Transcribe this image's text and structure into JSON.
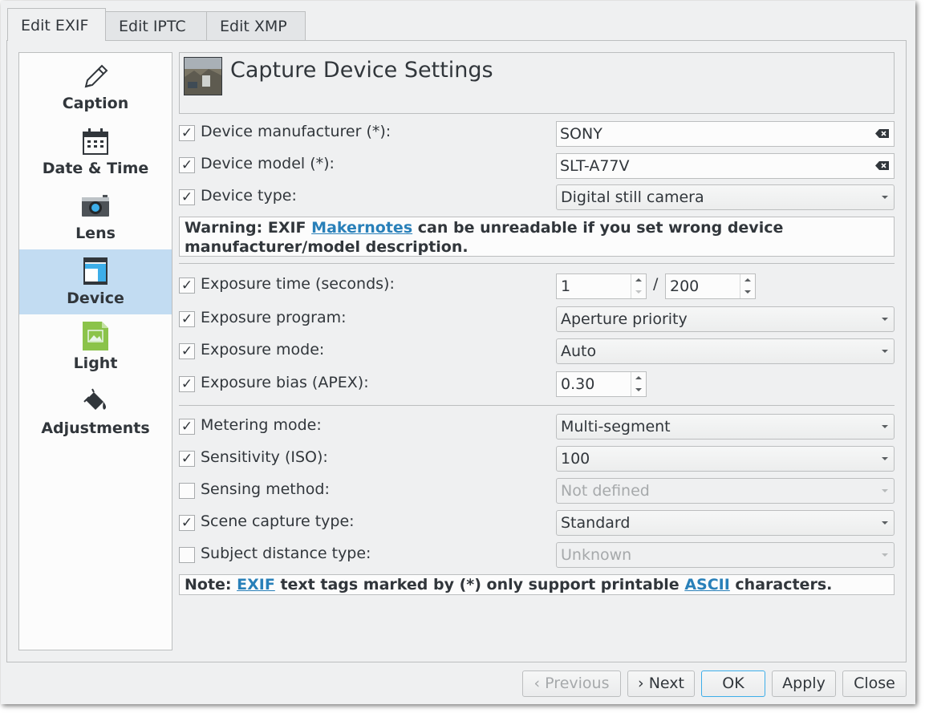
{
  "tabs": [
    {
      "label": "Edit EXIF"
    },
    {
      "label": "Edit IPTC"
    },
    {
      "label": "Edit XMP"
    }
  ],
  "sidebar": {
    "items": [
      {
        "label": "Caption",
        "icon": "pencil-icon"
      },
      {
        "label": "Date & Time",
        "icon": "calendar-icon"
      },
      {
        "label": "Lens",
        "icon": "camera-icon"
      },
      {
        "label": "Device",
        "icon": "device-icon",
        "selected": true
      },
      {
        "label": "Light",
        "icon": "image-icon"
      },
      {
        "label": "Adjustments",
        "icon": "paint-bucket-icon"
      }
    ]
  },
  "header": {
    "title": "Capture Device Settings"
  },
  "device": {
    "manufacturer": {
      "label": "Device manufacturer (*):",
      "checked": true,
      "value": "SONY"
    },
    "model": {
      "label": "Device model (*):",
      "checked": true,
      "value": "SLT-A77V"
    },
    "type": {
      "label": "Device type:",
      "checked": true,
      "value": "Digital still camera"
    }
  },
  "warning": {
    "prefix": "Warning: EXIF ",
    "link": "Makernotes",
    "suffix": " can be unreadable if you set wrong device manufacturer/model description."
  },
  "exposure": {
    "time": {
      "label": "Exposure time (seconds):",
      "checked": true,
      "numerator": "1",
      "separator": "/",
      "denominator": "200"
    },
    "program": {
      "label": "Exposure program:",
      "checked": true,
      "value": "Aperture priority"
    },
    "mode": {
      "label": "Exposure mode:",
      "checked": true,
      "value": "Auto"
    },
    "bias": {
      "label": "Exposure bias (APEX):",
      "checked": true,
      "value": "0.30"
    }
  },
  "metering": {
    "label": "Metering mode:",
    "checked": true,
    "value": "Multi-segment"
  },
  "sensitivity": {
    "label": "Sensitivity (ISO):",
    "checked": true,
    "value": "100"
  },
  "sensing": {
    "label": "Sensing method:",
    "checked": false,
    "value": "Not defined"
  },
  "scene": {
    "label": "Scene capture type:",
    "checked": true,
    "value": "Standard"
  },
  "subject_distance": {
    "label": "Subject distance type:",
    "checked": false,
    "value": "Unknown"
  },
  "note": {
    "prefix": "Note: ",
    "link1": "EXIF",
    "middle": " text tags marked by (*) only support printable ",
    "link2": "ASCII",
    "suffix": " characters."
  },
  "buttons": {
    "previous": "Previous",
    "next": "Next",
    "ok": "OK",
    "apply": "Apply",
    "close": "Close"
  },
  "colors": {
    "accent": "#3daee9",
    "selection": "#c2dcf2",
    "link": "#2980b9"
  }
}
